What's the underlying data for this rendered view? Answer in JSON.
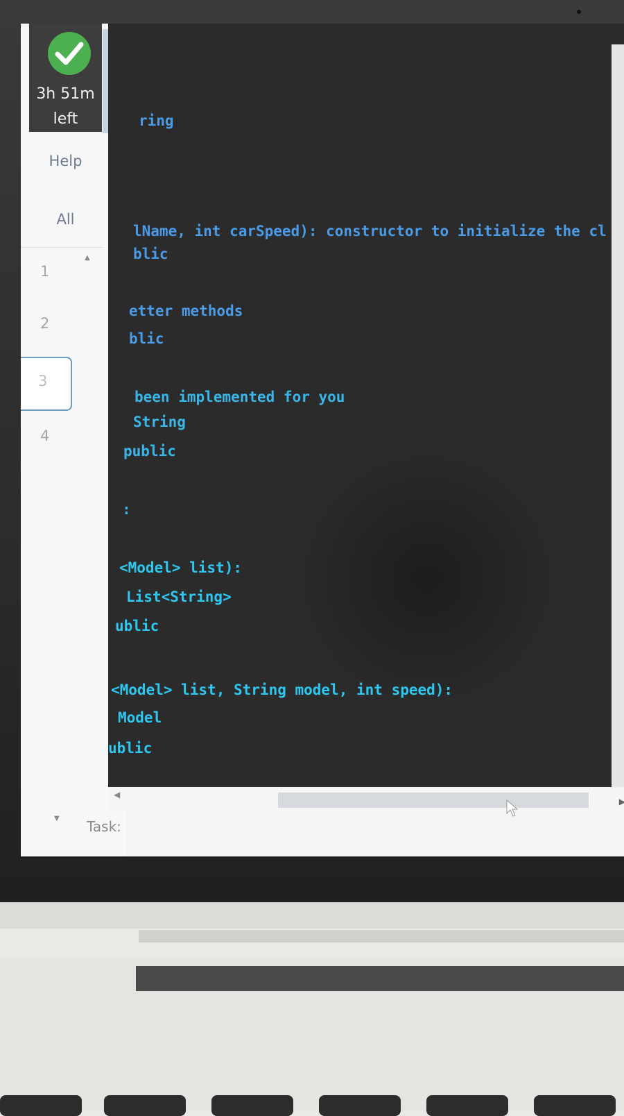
{
  "sidebar": {
    "timer": {
      "line1": "3h 51m",
      "line2": "left"
    },
    "help_label": "Help",
    "all_label": "All",
    "questions": [
      "1",
      "2",
      "3",
      "4"
    ]
  },
  "editor": {
    "lines": [
      {
        "text": "ring",
        "style": "comment"
      },
      {
        "text": "lName, int carSpeed): constructor to initialize the cl",
        "style": "comment"
      },
      {
        "text": "blic",
        "style": "comment"
      },
      {
        "text": "etter methods",
        "style": "comment"
      },
      {
        "text": "blic",
        "style": "comment"
      },
      {
        "text": "been implemented for you",
        "style": "text"
      },
      {
        "text": "String",
        "style": "text"
      },
      {
        "text": "public",
        "style": "text"
      },
      {
        "text": ":",
        "style": "text"
      },
      {
        "text": "<Model> list):",
        "style": "bright"
      },
      {
        "text": "List<String>",
        "style": "bright"
      },
      {
        "text": "ublic",
        "style": "bright"
      },
      {
        "text": "<Model> list, String model, int speed):",
        "style": "bright"
      },
      {
        "text": "Model",
        "style": "bright"
      },
      {
        "text": "ublic",
        "style": "bright"
      }
    ]
  },
  "footer": {
    "task_label": "Task:"
  },
  "colors": {
    "code_background": "#2b2b2b",
    "comment": "#4a9be8",
    "code_text": "#39b7e8",
    "timer_background": "#3d3d3d",
    "success": "#4caf50"
  },
  "icons": {
    "status": "check-icon",
    "scroll_up": "chevron-up-icon",
    "scroll_down": "chevron-down-icon",
    "scroll_left": "chevron-left-icon",
    "scroll_right": "chevron-right-icon",
    "cursor": "mouse-cursor-icon"
  }
}
